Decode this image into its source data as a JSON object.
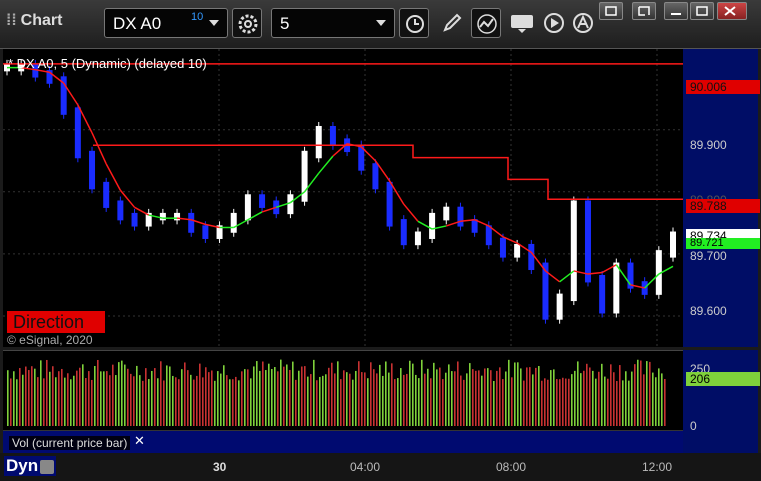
{
  "toolbar": {
    "app_title": "Chart",
    "symbol": "DX A0",
    "symbol_badge": "10",
    "interval": "5"
  },
  "chart": {
    "header": "* DX A0, 5 (Dynamic) (delayed 10)",
    "study_label": "Direction",
    "copyright": "© eSignal, 2020",
    "price_ticks": [
      "89.900",
      "89.700",
      "89.600"
    ],
    "price_tags": {
      "upper": "90.006",
      "mid_hidden": "89.800",
      "stop": "89.788",
      "last": "89.734",
      "avg": "89.721"
    },
    "volume_ticks": [
      "250",
      "0"
    ],
    "volume_tag": "206",
    "volume_label": "Vol (current price bar)",
    "volume_close": "✕",
    "time_ticks": [
      "30",
      "04:00",
      "08:00",
      "12:00"
    ],
    "footer_mode": "Dyn",
    "colors": {
      "up": "#ffffff",
      "down": "#1a2cff",
      "stop_line": "#ff1a1a",
      "avg_line": "#22ee22",
      "axis_bg": "#000d66",
      "vol_up": "#7fd13b",
      "vol_down": "#c83232"
    }
  },
  "chart_data": {
    "type": "line",
    "title": "* DX A0, 5 (Dynamic) (delayed 10)",
    "xlabel": "",
    "ylabel": "",
    "ylim": [
      89.55,
      90.03
    ],
    "x_ticks": [
      "30",
      "04:00",
      "08:00",
      "12:00"
    ],
    "series": [
      {
        "name": "",
        "values": [
          90.0,
          90.0,
          89.99,
          89.98,
          89.93,
          89.86,
          89.81,
          89.78,
          89.76,
          89.75,
          89.76,
          89.76,
          89.76,
          89.74,
          89.73,
          89.74,
          89.76,
          89.79,
          89.78,
          89.77,
          89.79,
          89.86,
          89.9,
          89.88,
          89.87,
          89.84,
          89.81,
          89.75,
          89.72,
          89.73,
          89.76,
          89.77,
          89.75,
          89.74,
          89.72,
          89.7,
          89.71,
          89.68,
          89.6,
          89.63,
          89.78,
          89.66,
          89.61,
          89.68,
          89.65,
          89.64,
          89.7,
          89.73
        ]
      }
    ],
    "levels": [
      {
        "name": "",
        "value": 90.006
      },
      {
        "name": "",
        "value": 89.788
      },
      {
        "name": "",
        "value": 89.734
      },
      {
        "name": "",
        "value": 89.721
      }
    ]
  }
}
